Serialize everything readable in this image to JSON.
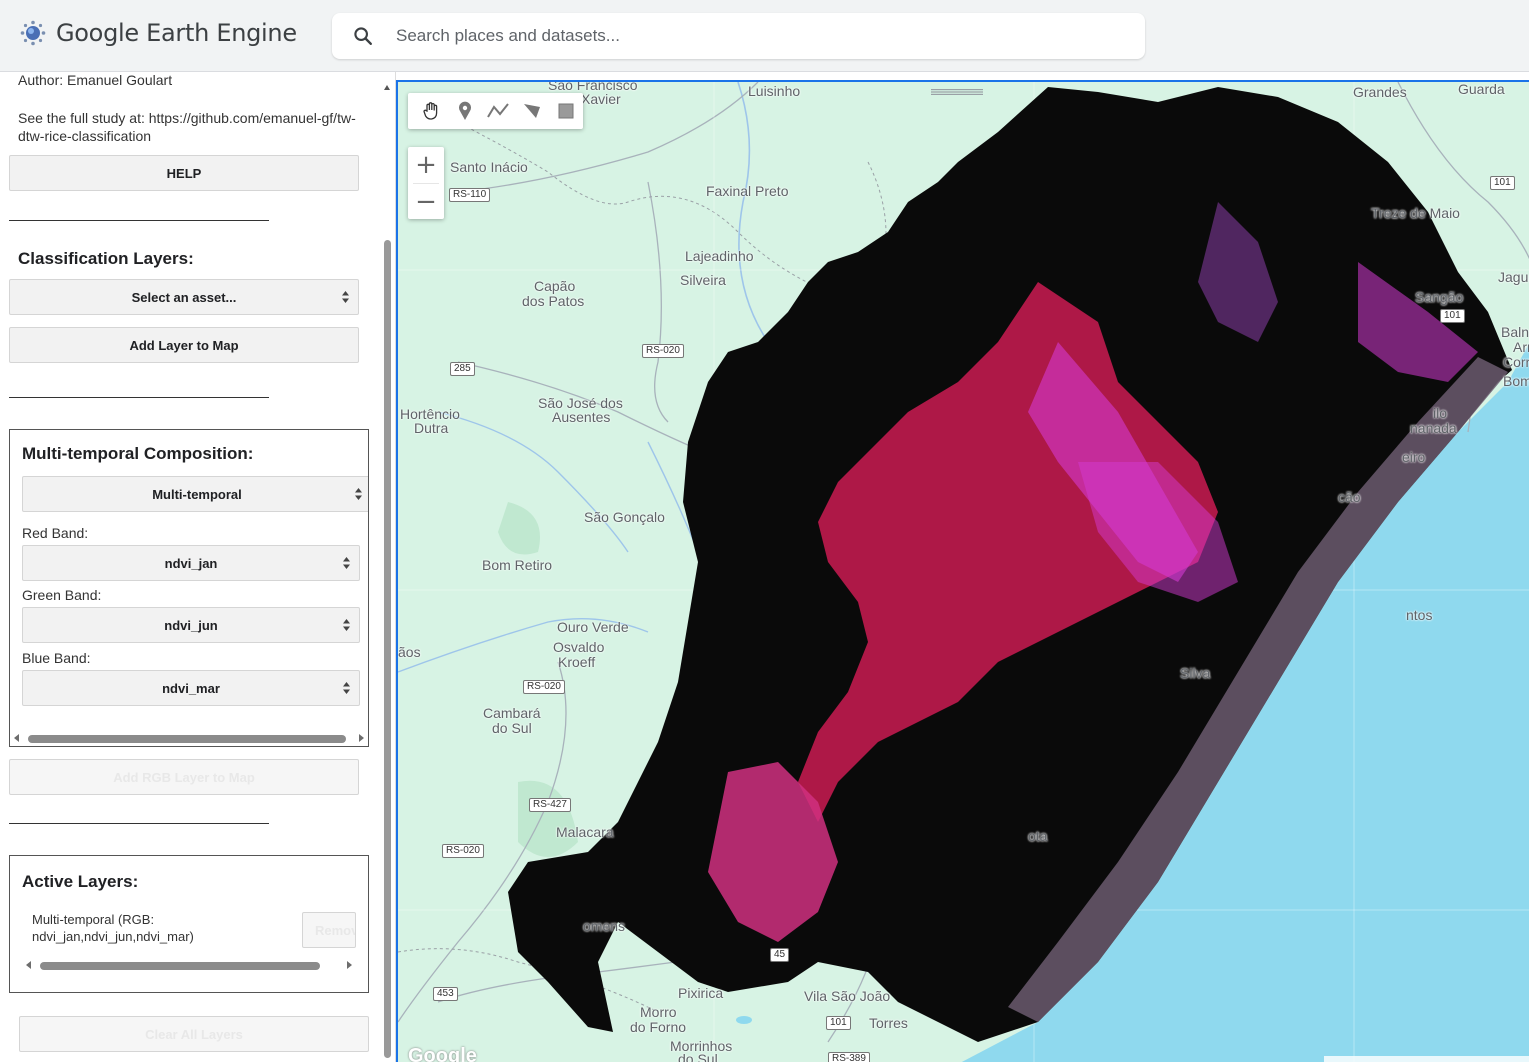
{
  "app": {
    "title": "Google Earth Engine",
    "search_placeholder": "Search places and datasets..."
  },
  "panel": {
    "author": "Author: Emanuel Goulart",
    "study_text": "See the full study at: https://github.com/emanuel-gf/tw-dtw-rice-classification",
    "help_button": "HELP",
    "classification": {
      "title": "Classification Layers:",
      "asset_select": "Select an asset...",
      "add_button": "Add Layer to Map"
    },
    "composition": {
      "title": "Multi-temporal Composition:",
      "mode_select": "Multi-temporal",
      "red_label": "Red Band:",
      "red_value": "ndvi_jan",
      "green_label": "Green Band:",
      "green_value": "ndvi_jun",
      "blue_label": "Blue Band:",
      "blue_value": "ndvi_mar",
      "add_rgb_button": "Add RGB Layer to Map"
    },
    "active_layers": {
      "title": "Active Layers:",
      "layer_line1": "Multi-temporal (RGB:",
      "layer_line2": "ndvi_jan,ndvi_jun,ndvi_mar)",
      "remove_button": "Remov",
      "clear_button": "Clear All Layers"
    }
  },
  "map": {
    "zoom_in": "+",
    "zoom_out": "−",
    "google": "Google",
    "places": {
      "sao_francisco": "São Francisco",
      "xavier": "Xavier",
      "luisinho": "Luisinho",
      "grandes": "Grandes",
      "guarda": "Guarda",
      "santo_inacio": "Santo Inácio",
      "faxinal_preto": "Faxinal Preto",
      "treze_de_maio": "Treze de Maio",
      "lajeadinho": "Lajeadinho",
      "silveira": "Silveira",
      "capao_dos_patos_1": "Capão",
      "capao_dos_patos_2": "dos Patos",
      "jagua": "Jagua",
      "sangao": "Sangão",
      "baln": "Baln",
      "arr": "Arr",
      "corr": "Corr",
      "bom": "Bom",
      "hortencio_1": "Hortêncio",
      "hortencio_2": "Dutra",
      "sao_jose_1": "São José dos",
      "sao_jose_2": "Ausentes",
      "nanada": "nanada",
      "ilo": "ilo",
      "eiro": "eiro",
      "sao_goncalo": "São Gonçalo",
      "cao": "cão",
      "bom_retiro": "Bom Retiro",
      "ntos": "ntos",
      "aos": "ãos",
      "ouro_verde": "Ouro Verde",
      "osvaldo_1": "Osvaldo",
      "osvaldo_2": "Kroeff",
      "silva": "Silva",
      "cambara_1": "Cambará",
      "cambara_2": "do Sul",
      "malacara": "Malacara",
      "ota": "ota",
      "omens": "omens",
      "pixirica": "Pixirica",
      "vila_sao_joao": "Vila São João",
      "torres": "Torres",
      "morro_1": "Morro",
      "morro_2": "do Forno",
      "morrinhos_1": "Morrinhos",
      "morrinhos_2": "do Sul"
    },
    "roads": {
      "rs110": "RS-110",
      "r101a": "101",
      "r101b": "101",
      "rs020a": "RS-020",
      "r285": "285",
      "rs020b": "RS-020",
      "rs427": "RS-427",
      "rs020c": "RS-020",
      "r453": "453",
      "r101c": "101",
      "rs389": "RS-389",
      "r45": "45"
    }
  },
  "colors": {
    "accent": "#1a73e8",
    "land": "#d7f3e4",
    "ocean": "#8fd9ee",
    "raster_dark": "#0a0a0a",
    "raster_red": "#e0215a",
    "raster_magenta": "#d43ad2"
  }
}
